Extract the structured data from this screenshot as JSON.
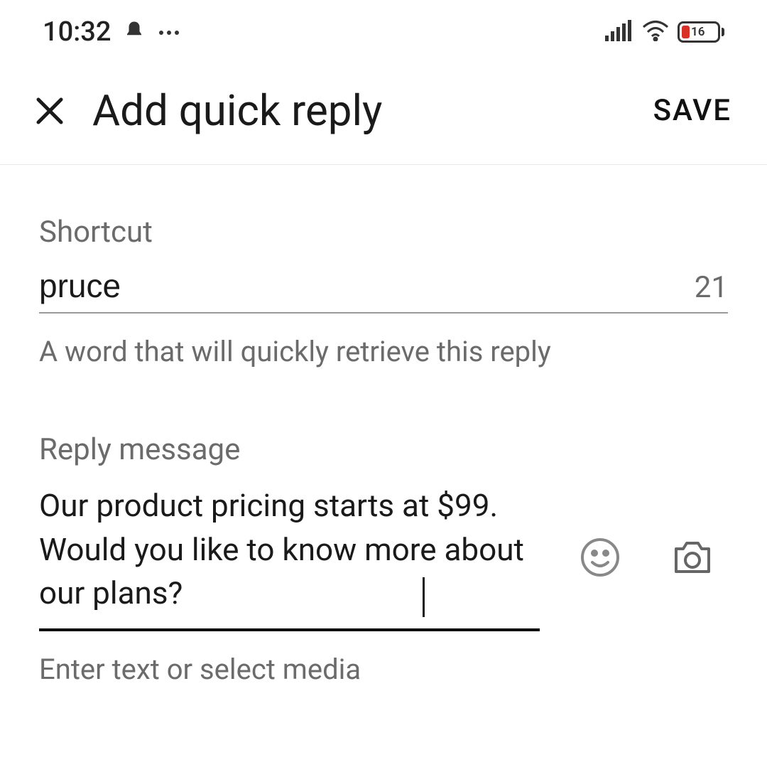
{
  "status": {
    "time": "10:32",
    "battery": "16"
  },
  "header": {
    "title": "Add quick reply",
    "save_label": "SAVE"
  },
  "shortcut": {
    "label": "Shortcut",
    "value": "pruce",
    "counter": "21",
    "helper": "A word that will quickly retrieve this reply"
  },
  "reply": {
    "label": "Reply message",
    "value": "Our product pricing starts at $99. Would you like to know more about our plans?",
    "helper": "Enter text or select media"
  }
}
